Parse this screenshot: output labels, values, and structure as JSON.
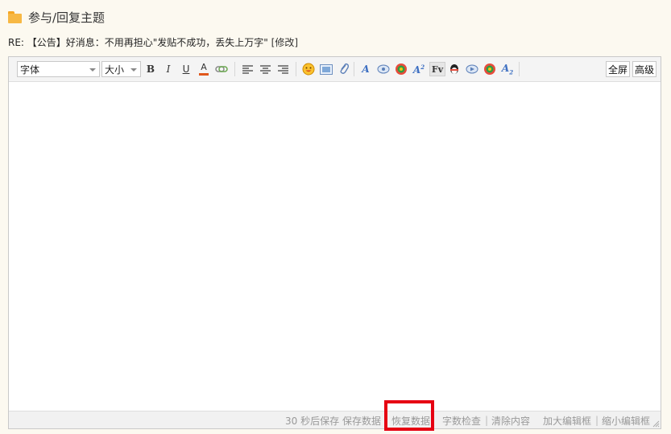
{
  "header": {
    "title": "参与/回复主题"
  },
  "subject": {
    "text": "RE: 【公告】好消息：不用再担心\"发贴不成功，丢失上万字\"",
    "edit_label": "[修改]"
  },
  "toolbar": {
    "font_select": "字体",
    "size_select": "大小",
    "bold": "B",
    "italic": "I",
    "underline": "U",
    "color": "A",
    "fullscreen": "全屏",
    "advanced": "高级"
  },
  "editor": {
    "content": ""
  },
  "statusbar": {
    "autosave": "30 秒后保存",
    "save_data": "保存数据",
    "restore_data": "恢复数据",
    "word_check": "字数检查",
    "clear_content": "清除内容",
    "enlarge": "加大编辑框",
    "shrink": "缩小编辑框"
  },
  "colors": {
    "folder": "#f7b844",
    "highlight": "#e60012",
    "page_bg": "#fcf9f0"
  }
}
